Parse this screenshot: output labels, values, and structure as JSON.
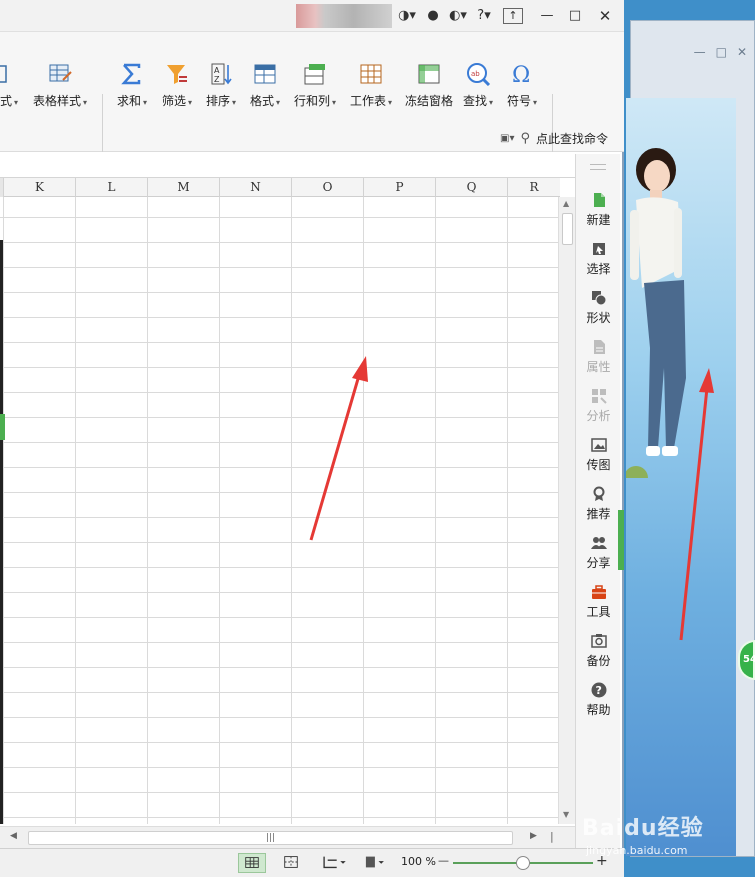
{
  "titlebar": {
    "controls": [
      "?",
      "minimize",
      "maximize",
      "close"
    ],
    "help_label": "?"
  },
  "ribbon": {
    "items": [
      {
        "id": "cell-style",
        "label": "式",
        "icon": "cell-style-icon"
      },
      {
        "id": "table-style",
        "label": "表格样式",
        "icon": "table-style-icon"
      },
      {
        "id": "sum",
        "label": "求和",
        "icon": "sigma-icon"
      },
      {
        "id": "filter",
        "label": "筛选",
        "icon": "filter-icon"
      },
      {
        "id": "sort",
        "label": "排序",
        "icon": "sort-icon"
      },
      {
        "id": "format",
        "label": "格式",
        "icon": "format-icon"
      },
      {
        "id": "row-col",
        "label": "行和列",
        "icon": "row-col-icon"
      },
      {
        "id": "worksheet",
        "label": "工作表",
        "icon": "worksheet-icon"
      },
      {
        "id": "freeze",
        "label": "冻结窗格",
        "icon": "freeze-icon"
      },
      {
        "id": "find",
        "label": "查找",
        "icon": "find-icon"
      },
      {
        "id": "symbol",
        "label": "符号",
        "icon": "omega-icon"
      }
    ],
    "find_command": "点此查找命令"
  },
  "sheet": {
    "columns": [
      "K",
      "L",
      "M",
      "N",
      "O",
      "P",
      "Q",
      "R"
    ]
  },
  "taskpane": {
    "items": [
      {
        "id": "new",
        "label": "新建",
        "icon": "new-file-icon",
        "enabled": true
      },
      {
        "id": "select",
        "label": "选择",
        "icon": "cursor-icon",
        "enabled": true
      },
      {
        "id": "shape",
        "label": "形状",
        "icon": "shape-icon",
        "enabled": true
      },
      {
        "id": "property",
        "label": "属性",
        "icon": "property-icon",
        "enabled": false
      },
      {
        "id": "analyze",
        "label": "分析",
        "icon": "analyze-icon",
        "enabled": false
      },
      {
        "id": "send-image",
        "label": "传图",
        "icon": "image-icon",
        "enabled": true
      },
      {
        "id": "recommend",
        "label": "推荐",
        "icon": "ribbon-award-icon",
        "enabled": true
      },
      {
        "id": "share",
        "label": "分享",
        "icon": "share-people-icon",
        "enabled": true
      },
      {
        "id": "tools",
        "label": "工具",
        "icon": "toolbox-icon",
        "enabled": true
      },
      {
        "id": "backup",
        "label": "备份",
        "icon": "backup-icon",
        "enabled": true
      },
      {
        "id": "help",
        "label": "帮助",
        "icon": "help-icon",
        "enabled": true
      }
    ]
  },
  "statusbar": {
    "zoom_label": "100 %",
    "zoom_minus": "—",
    "zoom_plus": "+"
  },
  "background_window": {
    "badge": "54"
  },
  "watermark": {
    "brand": "Baidu经验",
    "url": "jingyan.baidu.com"
  },
  "colors": {
    "accent_green": "#4caf50",
    "annotation_red": "#e53935",
    "sum_blue": "#3a7bd5",
    "filter_orange": "#f0a030"
  }
}
